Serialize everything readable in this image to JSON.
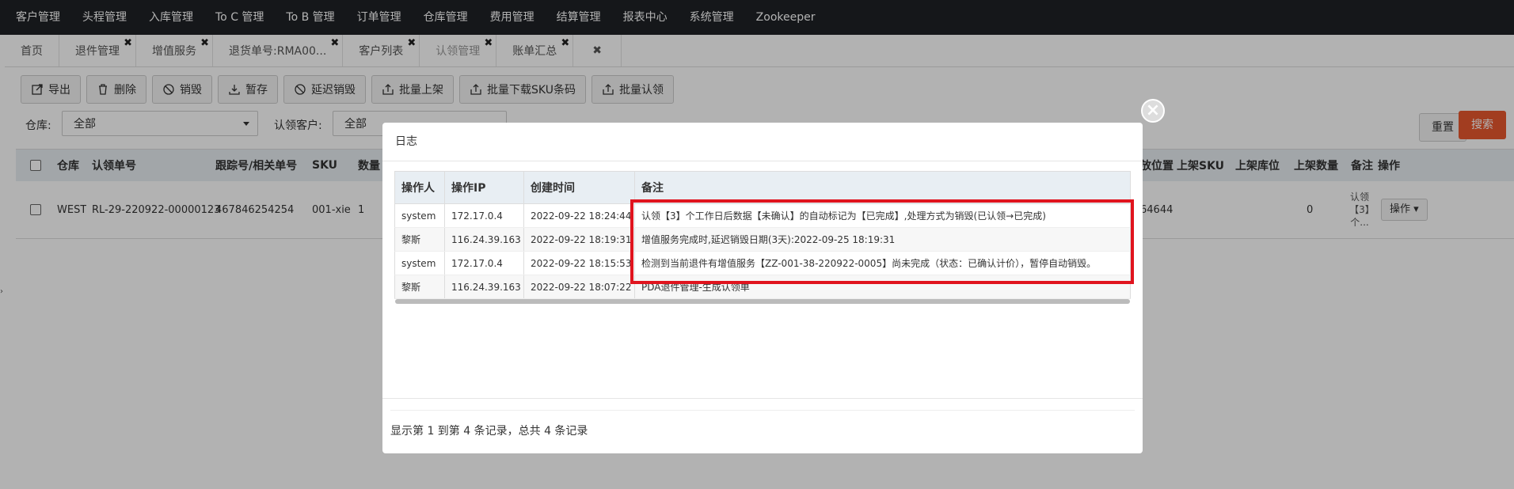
{
  "topnav": {
    "items": [
      "客户管理",
      "头程管理",
      "入库管理",
      "To C 管理",
      "To B 管理",
      "订单管理",
      "仓库管理",
      "费用管理",
      "结算管理",
      "报表中心",
      "系统管理",
      "Zookeeper"
    ]
  },
  "tabs": [
    {
      "label": "首页",
      "closable": false,
      "active": false
    },
    {
      "label": "退件管理",
      "closable": true,
      "active": false
    },
    {
      "label": "增值服务",
      "closable": true,
      "active": false
    },
    {
      "label": "退货单号:RMA00...",
      "closable": true,
      "active": false
    },
    {
      "label": "客户列表",
      "closable": true,
      "active": false
    },
    {
      "label": "认领管理",
      "closable": true,
      "active": true
    },
    {
      "label": "账单汇总",
      "closable": true,
      "active": false
    }
  ],
  "close_all_glyph": "✖",
  "toolbar": {
    "buttons": [
      {
        "label": "导出",
        "icon": "export-icon"
      },
      {
        "label": "删除",
        "icon": "trash-icon"
      },
      {
        "label": "销毁",
        "icon": "ban-icon"
      },
      {
        "label": "暂存",
        "icon": "download-icon"
      },
      {
        "label": "延迟销毁",
        "icon": "ban-icon"
      },
      {
        "label": "批量上架",
        "icon": "upload-icon"
      },
      {
        "label": "批量下载SKU条码",
        "icon": "upload-icon"
      },
      {
        "label": "批量认领",
        "icon": "upload-icon"
      }
    ]
  },
  "filters": {
    "warehouse_label": "仓库:",
    "warehouse_value": "全部",
    "customer_label": "认领客户:",
    "customer_value": "全部"
  },
  "actions": {
    "reset": "重置",
    "search": "搜索"
  },
  "grid": {
    "headers": [
      "仓库",
      "认领单号",
      "跟踪号/相关单号",
      "SKU",
      "数量",
      "放位置",
      "上架SKU",
      "上架库位",
      "上架数量",
      "备注",
      "操作"
    ],
    "row": {
      "warehouse": "WEST",
      "claim_no": "RL-29-220922-00000123",
      "tracking": "467846254254",
      "sku": "001-xie",
      "qty": "1",
      "location": "64644",
      "shelf_qty": "0",
      "note": "认领【3】个...",
      "op": "操作"
    }
  },
  "modal": {
    "title": "日志",
    "close_glyph": "×",
    "table": {
      "headers": [
        "操作人",
        "操作IP",
        "创建时间",
        "备注"
      ],
      "rows": [
        {
          "operator": "system",
          "ip": "172.17.0.4",
          "time": "2022-09-22 18:24:44",
          "note": "认领【3】个工作日后数据【未确认】的自动标记为【已完成】,处理方式为销毁(已认领→已完成)"
        },
        {
          "operator": "黎斯",
          "ip": "116.24.39.163",
          "time": "2022-09-22 18:19:31",
          "note": "增值服务完成时,延迟销毁日期(3天):2022-09-25 18:19:31"
        },
        {
          "operator": "system",
          "ip": "172.17.0.4",
          "time": "2022-09-22 18:15:53",
          "note": "检测到当前退件有增值服务【ZZ-001-38-220922-0005】尚未完成（状态：已确认计价），暂停自动销毁。"
        },
        {
          "operator": "黎斯",
          "ip": "116.24.39.163",
          "time": "2022-09-22 18:07:22",
          "note": "PDA退件管理-生成认领单"
        }
      ]
    },
    "footer": "显示第 1 到第 4 条记录，总共 4 条记录"
  },
  "colors": {
    "nav_bg": "#1f2226",
    "search_btn": "#e8582f",
    "highlight": "#e0141e",
    "header_bg": "#e8eef3"
  }
}
